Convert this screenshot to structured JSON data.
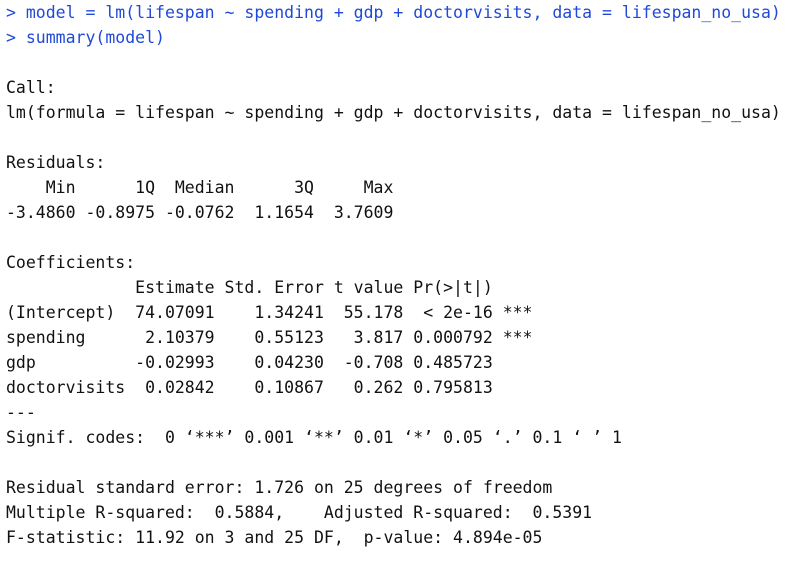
{
  "console": {
    "commands": [
      "> model = lm(lifespan ~ spending + gdp + doctorvisits, data = lifespan_no_usa)",
      "> summary(model)"
    ],
    "call_header": "Call:",
    "call_text": "lm(formula = lifespan ~ spending + gdp + doctorvisits, data = lifespan_no_usa)",
    "residuals": {
      "header": "Residuals:",
      "labels_line": "    Min      1Q  Median      3Q     Max ",
      "values_line": "-3.4860 -0.8975 -0.0762  1.1654  3.7609 "
    },
    "coefficients": {
      "header": "Coefficients:",
      "columns_line": "             Estimate Std. Error t value Pr(>|t|)    ",
      "rows": [
        "(Intercept)  74.07091    1.34241  55.178  < 2e-16 ***",
        "spending      2.10379    0.55123   3.817 0.000792 ***",
        "gdp          -0.02993    0.04230  -0.708 0.485723    ",
        "doctorvisits  0.02842    0.10867   0.262 0.795813    "
      ],
      "separator": "---",
      "signif_codes": "Signif. codes:  0 ‘***’ 0.001 ‘**’ 0.01 ‘*’ 0.05 ‘.’ 0.1 ‘ ’ 1"
    },
    "summary_stats": [
      "Residual standard error: 1.726 on 25 degrees of freedom",
      "Multiple R-squared:  0.5884,    Adjusted R-squared:  0.5391 ",
      "F-statistic: 11.92 on 3 and 25 DF,  p-value: 4.894e-05"
    ]
  }
}
